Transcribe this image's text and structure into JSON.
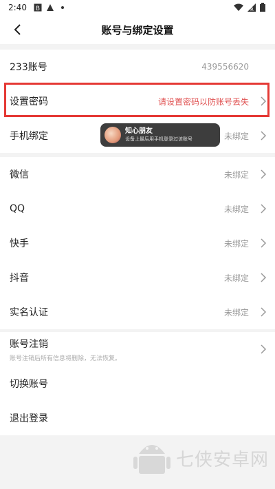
{
  "status": {
    "time": "2:40"
  },
  "nav": {
    "title": "账号与绑定设置"
  },
  "account": {
    "label": "233账号",
    "value": "439556620"
  },
  "password": {
    "label": "设置密码",
    "value": "请设置密码以防账号丢失"
  },
  "phone": {
    "label": "手机绑定",
    "value": "未绑定"
  },
  "toast": {
    "title": "知心朋友",
    "subtitle": "设备上最后用手机登录过该账号"
  },
  "bindings": [
    {
      "label": "微信",
      "value": "未绑定"
    },
    {
      "label": "QQ",
      "value": "未绑定"
    },
    {
      "label": "快手",
      "value": "未绑定"
    },
    {
      "label": "抖音",
      "value": "未绑定"
    },
    {
      "label": "实名认证",
      "value": "未绑定"
    }
  ],
  "cancel": {
    "label": "账号注销",
    "subtitle": "账号注销后所有信息将删除，无法恢复。"
  },
  "switch_account": {
    "label": "切换账号"
  },
  "logout": {
    "label": "退出登录"
  },
  "watermark": {
    "text": "七侠安卓网"
  },
  "colors": {
    "accent_red": "#e53935",
    "hint_red": "#e05252"
  }
}
